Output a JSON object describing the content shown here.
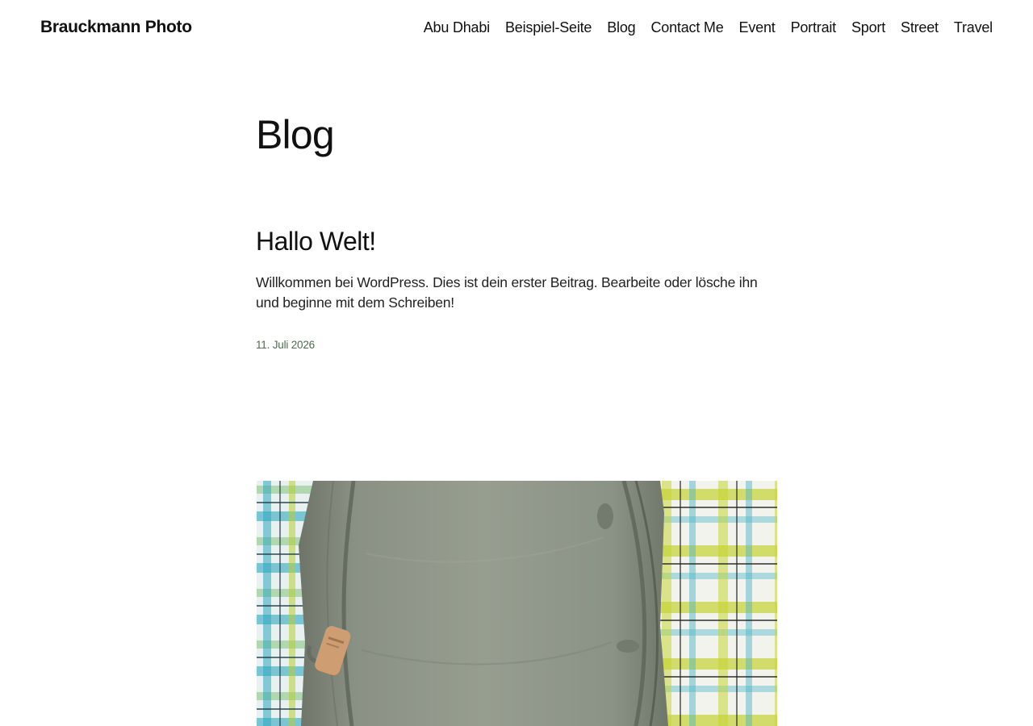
{
  "site": {
    "title": "Brauckmann Photo"
  },
  "nav": {
    "items": [
      {
        "label": "Abu Dhabi"
      },
      {
        "label": "Beispiel-Seite"
      },
      {
        "label": "Blog"
      },
      {
        "label": "Contact Me"
      },
      {
        "label": "Event"
      },
      {
        "label": "Portrait"
      },
      {
        "label": "Sport"
      },
      {
        "label": "Street"
      },
      {
        "label": "Travel"
      }
    ]
  },
  "page": {
    "title": "Blog"
  },
  "posts": [
    {
      "title": "Hallo Welt!",
      "excerpt": "Willkommen bei WordPress. Dies ist dein erster Beitrag. Bearbeite oder lösche ihn und beginne mit dem Schreiben!",
      "date": "11. Juli 2026"
    }
  ],
  "featured_image": {
    "subject": "grey backpack on checkered blanket"
  },
  "colors": {
    "text": "#111111",
    "date": "#4f6a4e",
    "background": "#ffffff"
  }
}
